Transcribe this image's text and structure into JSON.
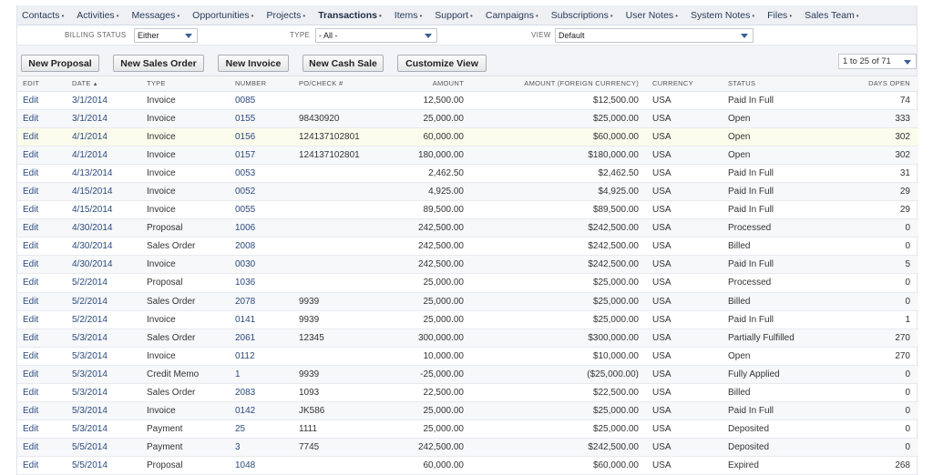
{
  "nav": [
    {
      "label": "Contacts",
      "name": "nav-contacts"
    },
    {
      "label": "Activities",
      "name": "nav-activities"
    },
    {
      "label": "Messages",
      "name": "nav-messages"
    },
    {
      "label": "Opportunities",
      "name": "nav-opportunities"
    },
    {
      "label": "Projects",
      "name": "nav-projects"
    },
    {
      "label": "Transactions",
      "name": "nav-transactions",
      "active": true
    },
    {
      "label": "Items",
      "name": "nav-items"
    },
    {
      "label": "Support",
      "name": "nav-support"
    },
    {
      "label": "Campaigns",
      "name": "nav-campaigns"
    },
    {
      "label": "Subscriptions",
      "name": "nav-subscriptions"
    },
    {
      "label": "User Notes",
      "name": "nav-user-notes"
    },
    {
      "label": "System Notes",
      "name": "nav-system-notes"
    },
    {
      "label": "Files",
      "name": "nav-files"
    },
    {
      "label": "Sales Team",
      "name": "nav-sales-team"
    }
  ],
  "filters": {
    "billing_status_label": "BILLING STATUS",
    "billing_status_value": "Either",
    "type_label": "TYPE",
    "type_value": "- All -",
    "view_label": "VIEW",
    "view_value": "Default"
  },
  "toolbar": {
    "new_proposal": "New Proposal",
    "new_sales_order": "New Sales Order",
    "new_invoice": "New Invoice",
    "new_cash_sale": "New Cash Sale",
    "customize_view": "Customize View",
    "pager": "1 to 25 of 71"
  },
  "table": {
    "headers": {
      "edit": "EDIT",
      "date": "DATE",
      "type": "TYPE",
      "number": "NUMBER",
      "pocheck": "PO/CHECK #",
      "amount": "AMOUNT",
      "amount_foreign": "AMOUNT (FOREIGN CURRENCY)",
      "currency": "CURRENCY",
      "status": "STATUS",
      "days_open": "DAYS OPEN"
    },
    "sort_indicator": "▲",
    "rows": [
      {
        "edit": "Edit",
        "date": "3/1/2014",
        "type": "Invoice",
        "number": "0085",
        "po": "",
        "amount": "12,500.00",
        "amount_fc": "$12,500.00",
        "currency": "USA",
        "status": "Paid In Full",
        "days": "74"
      },
      {
        "edit": "Edit",
        "date": "3/1/2014",
        "type": "Invoice",
        "number": "0155",
        "po": "98430920",
        "amount": "25,000.00",
        "amount_fc": "$25,000.00",
        "currency": "USA",
        "status": "Open",
        "days": "333"
      },
      {
        "edit": "Edit",
        "date": "4/1/2014",
        "type": "Invoice",
        "number": "0156",
        "po": "124137102801",
        "amount": "60,000.00",
        "amount_fc": "$60,000.00",
        "currency": "USA",
        "status": "Open",
        "days": "302"
      },
      {
        "edit": "Edit",
        "date": "4/1/2014",
        "type": "Invoice",
        "number": "0157",
        "po": "124137102801",
        "amount": "180,000.00",
        "amount_fc": "$180,000.00",
        "currency": "USA",
        "status": "Open",
        "days": "302"
      },
      {
        "edit": "Edit",
        "date": "4/13/2014",
        "type": "Invoice",
        "number": "0053",
        "po": "",
        "amount": "2,462.50",
        "amount_fc": "$2,462.50",
        "currency": "USA",
        "status": "Paid In Full",
        "days": "31"
      },
      {
        "edit": "Edit",
        "date": "4/15/2014",
        "type": "Invoice",
        "number": "0052",
        "po": "",
        "amount": "4,925.00",
        "amount_fc": "$4,925.00",
        "currency": "USA",
        "status": "Paid In Full",
        "days": "29"
      },
      {
        "edit": "Edit",
        "date": "4/15/2014",
        "type": "Invoice",
        "number": "0055",
        "po": "",
        "amount": "89,500.00",
        "amount_fc": "$89,500.00",
        "currency": "USA",
        "status": "Paid In Full",
        "days": "29"
      },
      {
        "edit": "Edit",
        "date": "4/30/2014",
        "type": "Proposal",
        "number": "1006",
        "po": "",
        "amount": "242,500.00",
        "amount_fc": "$242,500.00",
        "currency": "USA",
        "status": "Processed",
        "days": "0"
      },
      {
        "edit": "Edit",
        "date": "4/30/2014",
        "type": "Sales Order",
        "number": "2008",
        "po": "",
        "amount": "242,500.00",
        "amount_fc": "$242,500.00",
        "currency": "USA",
        "status": "Billed",
        "days": "0"
      },
      {
        "edit": "Edit",
        "date": "4/30/2014",
        "type": "Invoice",
        "number": "0030",
        "po": "",
        "amount": "242,500.00",
        "amount_fc": "$242,500.00",
        "currency": "USA",
        "status": "Paid In Full",
        "days": "5"
      },
      {
        "edit": "Edit",
        "date": "5/2/2014",
        "type": "Proposal",
        "number": "1036",
        "po": "",
        "amount": "25,000.00",
        "amount_fc": "$25,000.00",
        "currency": "USA",
        "status": "Processed",
        "days": "0"
      },
      {
        "edit": "Edit",
        "date": "5/2/2014",
        "type": "Sales Order",
        "number": "2078",
        "po": "9939",
        "amount": "25,000.00",
        "amount_fc": "$25,000.00",
        "currency": "USA",
        "status": "Billed",
        "days": "0"
      },
      {
        "edit": "Edit",
        "date": "5/2/2014",
        "type": "Invoice",
        "number": "0141",
        "po": "9939",
        "amount": "25,000.00",
        "amount_fc": "$25,000.00",
        "currency": "USA",
        "status": "Paid In Full",
        "days": "1"
      },
      {
        "edit": "Edit",
        "date": "5/3/2014",
        "type": "Sales Order",
        "number": "2061",
        "po": "12345",
        "amount": "300,000.00",
        "amount_fc": "$300,000.00",
        "currency": "USA",
        "status": "Partially Fulfilled",
        "days": "270"
      },
      {
        "edit": "Edit",
        "date": "5/3/2014",
        "type": "Invoice",
        "number": "0112",
        "po": "",
        "amount": "10,000.00",
        "amount_fc": "$10,000.00",
        "currency": "USA",
        "status": "Open",
        "days": "270"
      },
      {
        "edit": "Edit",
        "date": "5/3/2014",
        "type": "Credit Memo",
        "number": "1",
        "po": "9939",
        "amount": "-25,000.00",
        "amount_fc": "($25,000.00)",
        "currency": "USA",
        "status": "Fully Applied",
        "days": "0"
      },
      {
        "edit": "Edit",
        "date": "5/3/2014",
        "type": "Sales Order",
        "number": "2083",
        "po": "1093",
        "amount": "22,500.00",
        "amount_fc": "$22,500.00",
        "currency": "USA",
        "status": "Billed",
        "days": "0"
      },
      {
        "edit": "Edit",
        "date": "5/3/2014",
        "type": "Invoice",
        "number": "0142",
        "po": "JK586",
        "amount": "25,000.00",
        "amount_fc": "$25,000.00",
        "currency": "USA",
        "status": "Paid In Full",
        "days": "0"
      },
      {
        "edit": "Edit",
        "date": "5/3/2014",
        "type": "Payment",
        "number": "25",
        "po": "1111",
        "amount": "25,000.00",
        "amount_fc": "$25,000.00",
        "currency": "USA",
        "status": "Deposited",
        "days": "0"
      },
      {
        "edit": "Edit",
        "date": "5/5/2014",
        "type": "Payment",
        "number": "3",
        "po": "7745",
        "amount": "242,500.00",
        "amount_fc": "$242,500.00",
        "currency": "USA",
        "status": "Deposited",
        "days": "0"
      },
      {
        "edit": "Edit",
        "date": "5/5/2014",
        "type": "Proposal",
        "number": "1048",
        "po": "",
        "amount": "60,000.00",
        "amount_fc": "$60,000.00",
        "currency": "USA",
        "status": "Expired",
        "days": "268"
      }
    ]
  }
}
